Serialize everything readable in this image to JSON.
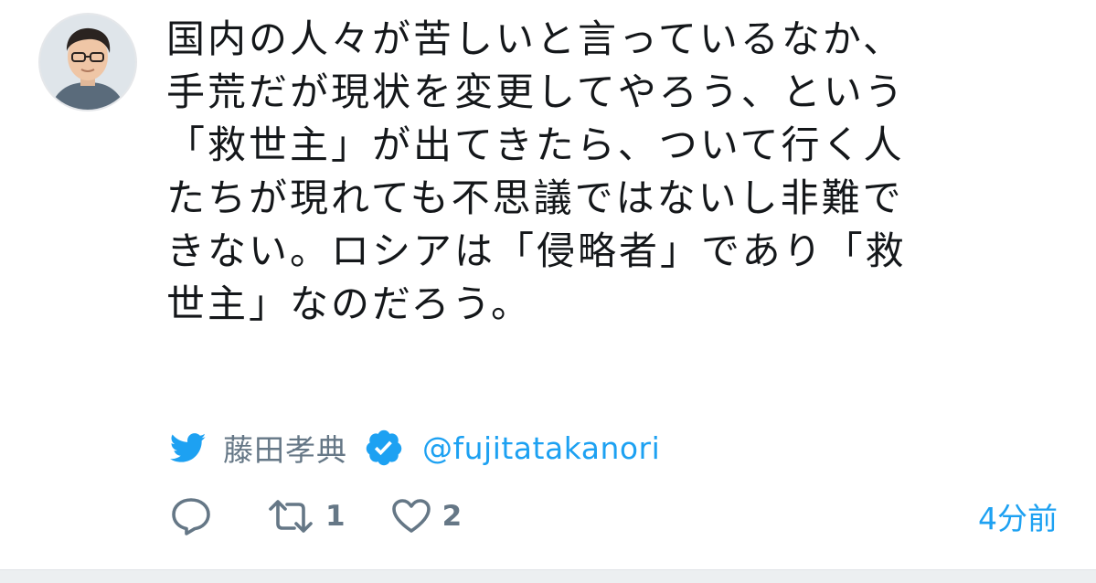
{
  "tweet": {
    "lines": [
      "国内の人々が苦しいと言っているなか、",
      "手荒だが現状を変更してやろう、という",
      "「救世主」が出てきたら、ついて行く人",
      "たちが現れても不思議ではないし非難で",
      "きない。ロシアは「侵略者」であり「救",
      "世主」なのだろう。"
    ]
  },
  "author": {
    "avatar_icon": "avatar-photo",
    "name": "藤田孝典",
    "verified_icon": "verified-badge-icon",
    "handle": "@fujitatakanori"
  },
  "attribution": {
    "source_icon": "twitter-bird-icon"
  },
  "actions": {
    "reply": {
      "icon": "reply-icon",
      "count": ""
    },
    "retweet": {
      "icon": "retweet-icon",
      "count": "1"
    },
    "like": {
      "icon": "heart-icon",
      "count": "2"
    }
  },
  "timestamp": "4分前",
  "colors": {
    "text": "#14171a",
    "muted": "#657786",
    "accent": "#1da1f2"
  }
}
